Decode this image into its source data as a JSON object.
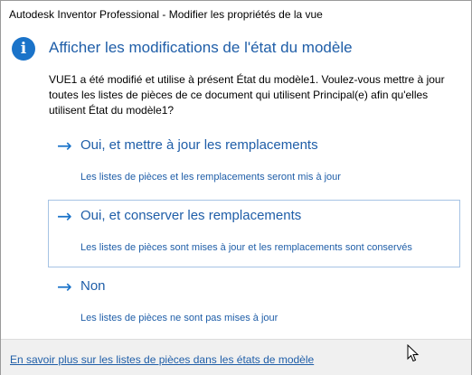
{
  "window": {
    "title": "Autodesk Inventor Professional - Modifier les propriétés de la vue"
  },
  "dialog": {
    "heading": "Afficher les modifications de l'état du modèle",
    "message": "VUE1 a été modifié et utilise à présent État du modèle1. Voulez-vous mettre à jour toutes les listes de pièces de ce document qui utilisent Principal(e) afin qu'elles utilisent État du modèle1?",
    "options": [
      {
        "arrow": "→",
        "title": "Oui, et mettre à jour les remplacements",
        "description": "Les listes de pièces et les remplacements seront mis à jour"
      },
      {
        "arrow": "→",
        "title": "Oui, et conserver les remplacements",
        "description": "Les listes de pièces sont mises à jour et les remplacements sont conservés"
      },
      {
        "arrow": "→",
        "title": "Non",
        "description": "Les listes de pièces ne sont pas mises à jour"
      }
    ]
  },
  "footer": {
    "link": "En savoir plus sur les listes de pièces dans les états de modèle"
  },
  "icons": {
    "info": "info-icon",
    "arrow": "arrow-right-icon",
    "cursor": "mouse-pointer-icon"
  },
  "colors": {
    "accent": "#1a73c9",
    "link_text": "#1f5ea8",
    "footer_bg": "#f0f0f0",
    "selected_border": "#a6c3e4"
  }
}
